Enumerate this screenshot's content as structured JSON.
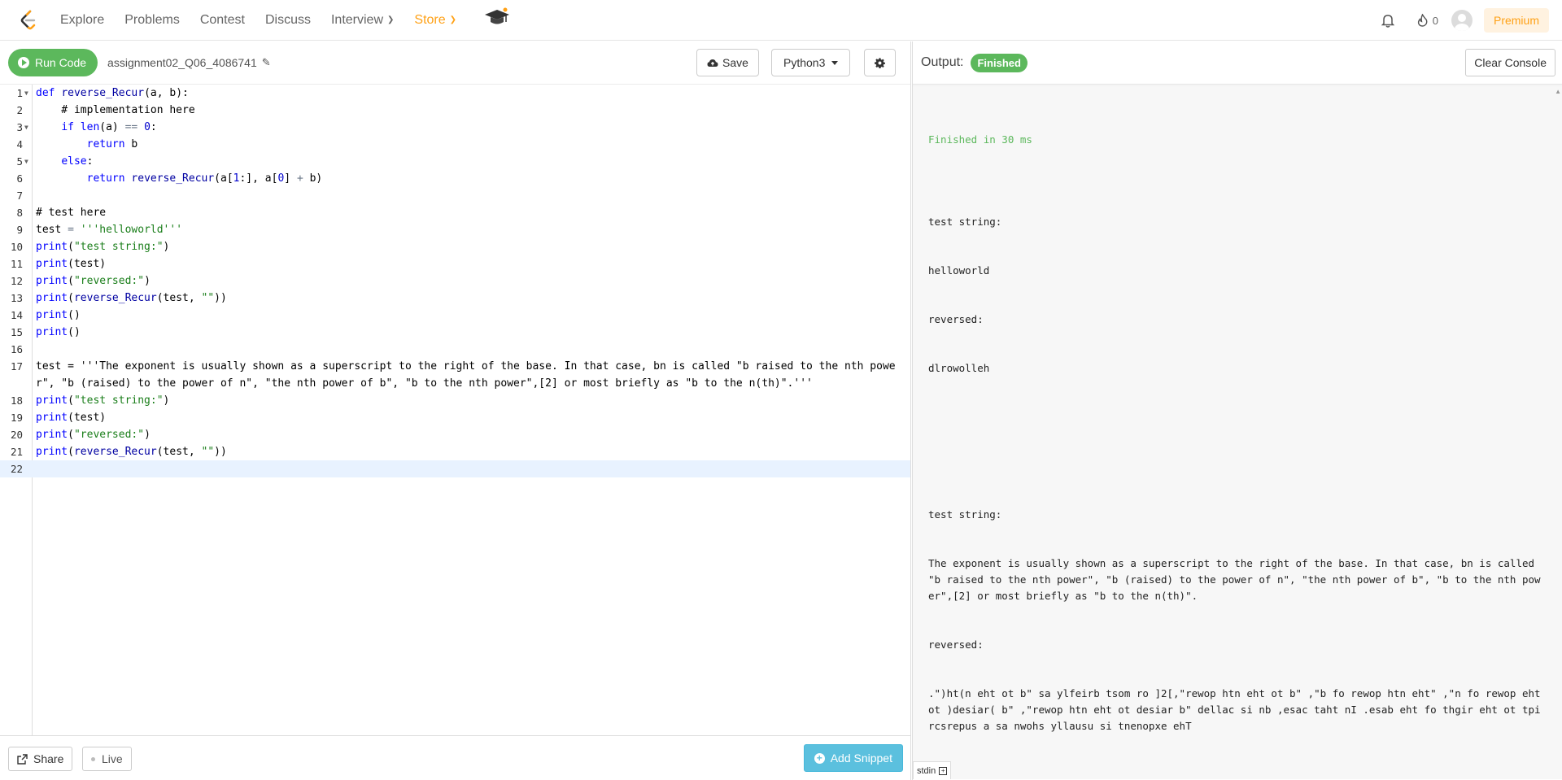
{
  "nav": {
    "logo_icon": "leetcode-logo-icon",
    "items": [
      "Explore",
      "Problems",
      "Contest",
      "Discuss",
      "Interview",
      "Store"
    ],
    "interview_label": "Interview",
    "store_label": "Store",
    "streak_count": "0",
    "premium_label": "Premium",
    "accent": "#ffa116"
  },
  "toolbar": {
    "run_label": "Run Code",
    "filename": "assignment02_Q06_4086741",
    "save_label": "Save",
    "language": "Python3"
  },
  "editor": {
    "line_numbers": [
      "1",
      "2",
      "3",
      "4",
      "5",
      "6",
      "7",
      "8",
      "9",
      "10",
      "11",
      "12",
      "13",
      "14",
      "15",
      "16",
      "17",
      "18",
      "19",
      "20",
      "21",
      "22"
    ],
    "lines": [
      "def reverse_Recur(a, b):",
      "    # implementation here",
      "    if len(a) == 0:",
      "        return b",
      "    else:",
      "        return reverse_Recur(a[1:], a[0] + b)",
      "",
      "# test here",
      "test = '''helloworld'''",
      "print(\"test string:\")",
      "print(test)",
      "print(\"reversed:\")",
      "print(reverse_Recur(test, \"\"))",
      "print()",
      "print()",
      "",
      "test = '''The exponent is usually shown as a superscript to the right of the base. In that case, bn is called \"b raised to the nth power\", \"b (raised) to the power of n\", \"the nth power of b\", \"b to the nth power\",[2] or most briefly as \"b to the n(th)\".'''",
      "print(\"test string:\")",
      "print(test)",
      "print(\"reversed:\")",
      "print(reverse_Recur(test, \"\"))",
      ""
    ]
  },
  "bottom": {
    "share_label": "Share",
    "live_label": "Live",
    "snippet_label": "Add Snippet"
  },
  "output": {
    "label": "Output:",
    "status": "Finished",
    "clear_label": "Clear Console",
    "finished_text": "Finished in 30 ms",
    "lines": [
      "test string:",
      "helloworld",
      "reversed:",
      "dlrowolleh",
      "",
      "",
      "test string:",
      "The exponent is usually shown as a superscript to the right of the base. In that case, bn is called \"b raised to the nth power\", \"b (raised) to the power of n\", \"the nth power of b\", \"b to the nth power\",[2] or most briefly as \"b to the n(th)\".",
      "reversed:",
      ".\")ht(n eht ot b\" sa ylfeirb tsom ro ]2[,\"rewop htn eht ot b\" ,\"b fo rewop htn eht\" ,\"n fo rewop eht ot )desiar( b\" ,\"rewop htn eht ot desiar b\" dellac si nb ,esac taht nI .esab eht fo thgir eht ot tpircsrepus a sa nwohs yllausu si tnenopxe ehT"
    ],
    "stdin_label": "stdin",
    "status_color": "#5cb85c"
  }
}
